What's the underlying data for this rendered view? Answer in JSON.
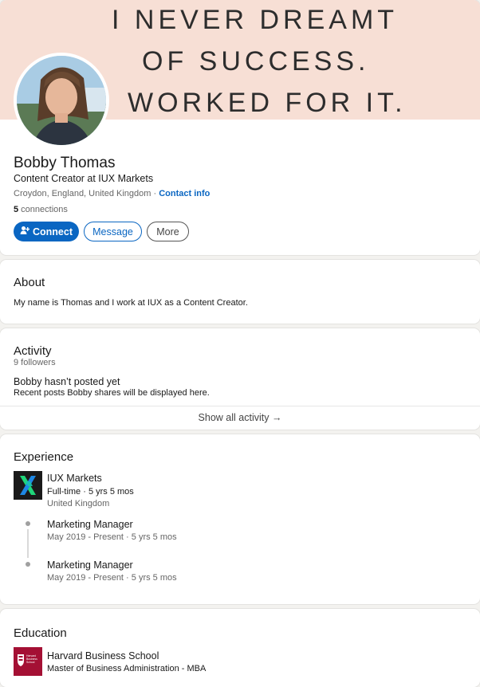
{
  "banner": {
    "line1": "I NEVER DREAMT",
    "line2": "OF SUCCESS.",
    "line3": "WORKED FOR IT."
  },
  "profile": {
    "name": "Bobby Thomas",
    "headline": "Content Creator at IUX Markets",
    "location": "Croydon, England, United Kingdom",
    "separator": " · ",
    "contact_info": "Contact info",
    "connections_count": "5",
    "connections_label": " connections"
  },
  "actions": {
    "connect": "Connect",
    "message": "Message",
    "more": "More"
  },
  "about": {
    "title": "About",
    "text": "My name is Thomas and I work at IUX as a Content Creator."
  },
  "activity": {
    "title": "Activity",
    "followers": "9 followers",
    "empty_title": "Bobby hasn’t posted yet",
    "empty_text": "Recent posts Bobby shares will be displayed here.",
    "show_all": "Show all activity →"
  },
  "experience": {
    "title": "Experience",
    "company": "IUX Markets",
    "company_meta": "Full-time · 5 yrs 5 mos",
    "company_location": "United Kingdom",
    "roles": [
      {
        "title": "Marketing Manager",
        "dates": "May 2019 - Present · 5 yrs 5 mos"
      },
      {
        "title": "Marketing Manager",
        "dates": "May 2019 - Present · 5 yrs 5 mos"
      }
    ]
  },
  "education": {
    "title": "Education",
    "school": "Harvard Business School",
    "degree": "Master of Business Administration - MBA",
    "logo_text": "Harvard Business School"
  },
  "colors": {
    "accent": "#0a66c2",
    "banner": "#f7dfd5",
    "school": "#a41034",
    "company_logo_green": "#1fd67a",
    "company_logo_blue": "#1e88e5"
  }
}
